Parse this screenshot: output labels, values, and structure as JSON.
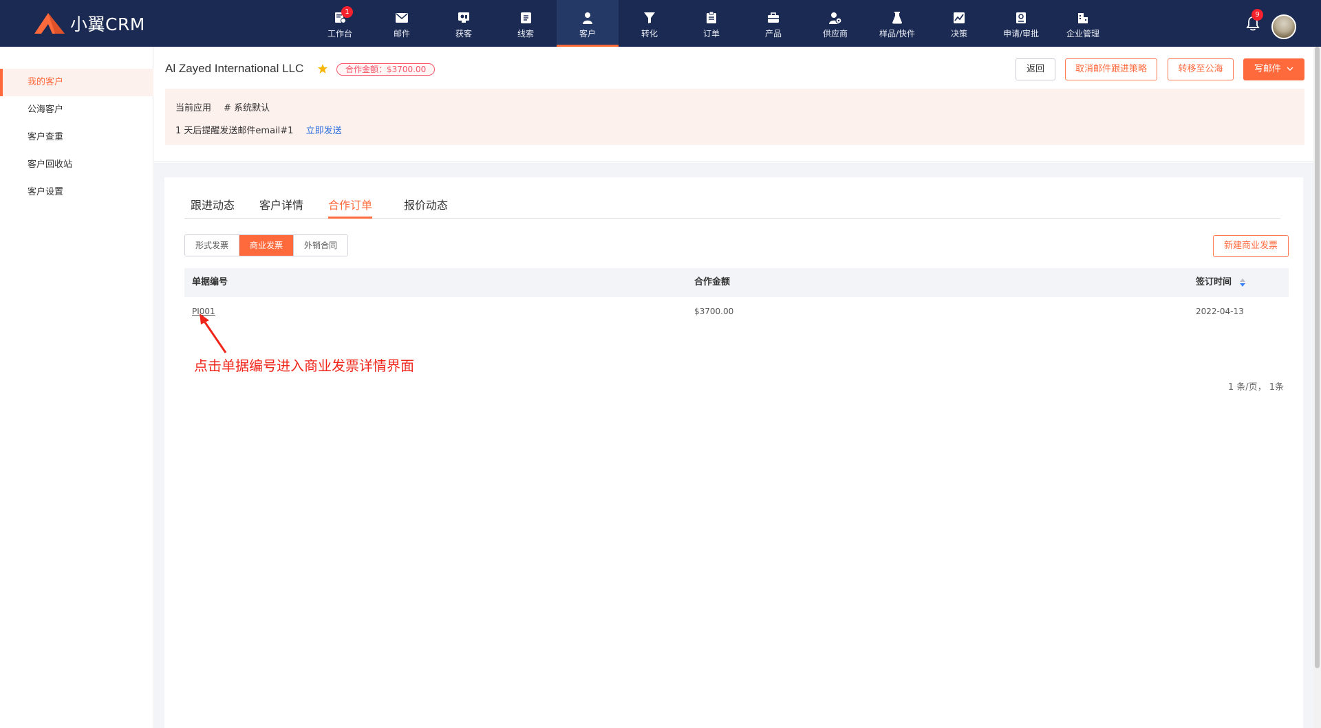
{
  "app": {
    "logo_text": "小翼CRM",
    "accent": "#ff6a3d",
    "nav_bg": "#1b2a52"
  },
  "nav": {
    "items": [
      {
        "label": "工作台",
        "icon": "workbench-icon",
        "badge": "1"
      },
      {
        "label": "邮件",
        "icon": "mail-icon"
      },
      {
        "label": "获客",
        "icon": "acquire-icon"
      },
      {
        "label": "线索",
        "icon": "leads-icon"
      },
      {
        "label": "客户",
        "icon": "customer-icon",
        "active": true
      },
      {
        "label": "转化",
        "icon": "funnel-icon"
      },
      {
        "label": "订单",
        "icon": "order-icon"
      },
      {
        "label": "产品",
        "icon": "product-icon"
      },
      {
        "label": "供应商",
        "icon": "supplier-icon"
      },
      {
        "label": "样品/快件",
        "icon": "sample-icon"
      },
      {
        "label": "决策",
        "icon": "chart-icon"
      },
      {
        "label": "申请/审批",
        "icon": "approval-icon"
      },
      {
        "label": "企业管理",
        "icon": "enterprise-icon"
      }
    ],
    "bell_badge": "9"
  },
  "sidebar": {
    "items": [
      {
        "label": "我的客户",
        "active": true
      },
      {
        "label": "公海客户"
      },
      {
        "label": "客户查重"
      },
      {
        "label": "客户回收站"
      },
      {
        "label": "客户设置"
      }
    ]
  },
  "header": {
    "customer_name": "Al Zayed International LLC",
    "amount_tag": "合作金额：$3700.00",
    "buttons": {
      "back": "返回",
      "cancel_strategy": "取消邮件跟进策略",
      "transfer": "转移至公海",
      "write_mail": "写邮件"
    },
    "notice": {
      "current_app_label": "当前应用",
      "current_app_value": "# 系统默认",
      "reminder": "1 天后提醒发送邮件email#1",
      "send_now": "立即发送"
    }
  },
  "tabs": [
    {
      "label": "跟进动态"
    },
    {
      "label": "客户详情"
    },
    {
      "label": "合作订单",
      "active": true
    },
    {
      "label": "报价动态"
    }
  ],
  "subtabs": [
    {
      "label": "形式发票"
    },
    {
      "label": "商业发票",
      "active": true
    },
    {
      "label": "外销合同"
    }
  ],
  "new_button": "新建商业发票",
  "table": {
    "headers": {
      "code": "单据编号",
      "amount": "合作金额",
      "signed": "签订时间"
    },
    "rows": [
      {
        "code": "PI001",
        "amount": "$3700.00",
        "signed": "2022-04-13"
      }
    ]
  },
  "annotation": "点击单据编号进入商业发票详情界面",
  "pager": "1 条/页， 1条"
}
